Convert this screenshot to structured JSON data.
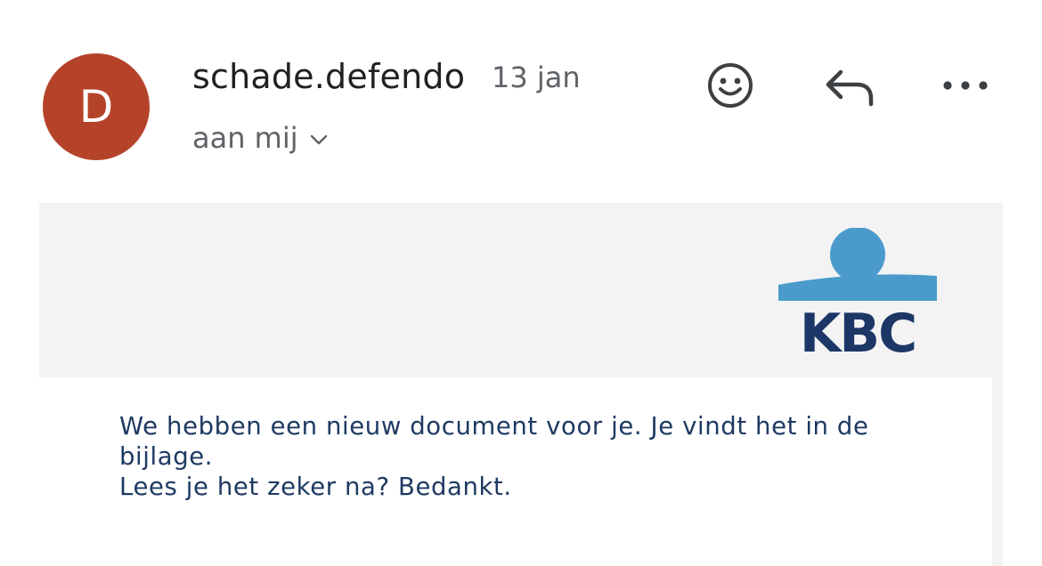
{
  "message": {
    "avatar_letter": "D",
    "avatar_color": "#b5432a",
    "sender": "schade.defendo",
    "date": "13 jan",
    "recipient": "aan mij",
    "recipient_icon": "chevron-down-icon"
  },
  "actions": {
    "emoji_icon": "smiley-icon",
    "reply_icon": "reply-icon",
    "more_icon": "more-horizontal-icon"
  },
  "email": {
    "brand": "KBC",
    "brand_colors": {
      "navy": "#1c3766",
      "light_blue": "#4a9bcb"
    },
    "body_lines": [
      "We hebben een nieuw document voor je. Je vindt het in de bijlage.",
      "Lees je het zeker na? Bedankt."
    ],
    "text_color": "#1f3a63",
    "band_color": "#f3f3f4"
  }
}
